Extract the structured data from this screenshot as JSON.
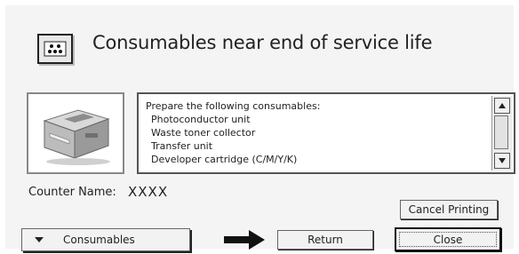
{
  "dialog": {
    "title": "Consumables near end of service life",
    "title_icon": "consumables-icon"
  },
  "message": {
    "lines": [
      "Prepare the following consumables:",
      "Photoconductor unit",
      "Waste toner collector",
      "Transfer unit",
      "Developer cartridge (C/M/Y/K)"
    ]
  },
  "counter": {
    "label": "Counter Name:",
    "value": "XXXX"
  },
  "buttons": {
    "cancel_printing": "Cancel Printing",
    "consumables": "Consumables",
    "return": "Return",
    "close": "Close"
  },
  "icons": {
    "printer": "printer-icon",
    "arrow": "arrow-right-icon",
    "scroll_up": "scroll-up-arrow-icon",
    "scroll_down": "scroll-down-arrow-icon",
    "dropdown": "chevron-down-icon"
  }
}
